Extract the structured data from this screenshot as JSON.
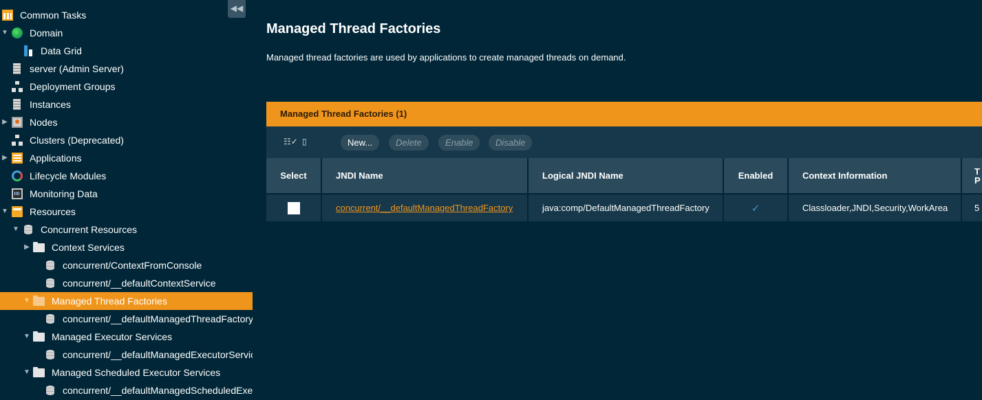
{
  "sidebar": {
    "collapse_glyph": "◀◀",
    "items": [
      {
        "label": "Common Tasks",
        "icon": "table-icon",
        "toggle": "",
        "level": 0
      },
      {
        "label": "Domain",
        "icon": "globe-icon",
        "toggle": "▼",
        "level": 0
      },
      {
        "label": "Data Grid",
        "icon": "data-grid-icon",
        "toggle": "",
        "level": 1
      },
      {
        "label": "server (Admin Server)",
        "icon": "server-icon",
        "toggle": "",
        "level": 0
      },
      {
        "label": "Deployment Groups",
        "icon": "tree-icon",
        "toggle": "",
        "level": 0
      },
      {
        "label": "Instances",
        "icon": "server-icon",
        "toggle": "",
        "level": 0
      },
      {
        "label": "Nodes",
        "icon": "monitor-icon",
        "toggle": "▶",
        "level": 0
      },
      {
        "label": "Clusters (Deprecated)",
        "icon": "tree-icon",
        "toggle": "",
        "level": 0
      },
      {
        "label": "Applications",
        "icon": "applications-icon",
        "toggle": "▶",
        "level": 0
      },
      {
        "label": "Lifecycle Modules",
        "icon": "lifecycle-icon",
        "toggle": "",
        "level": 0
      },
      {
        "label": "Monitoring Data",
        "icon": "monitoring-icon",
        "toggle": "",
        "level": 0
      },
      {
        "label": "Resources",
        "icon": "resources-icon",
        "toggle": "▼",
        "level": 0
      },
      {
        "label": "Concurrent Resources",
        "icon": "database-icon",
        "toggle": "▼",
        "level": 1
      },
      {
        "label": "Context Services",
        "icon": "folder-icon",
        "toggle": "▶",
        "level": 2
      },
      {
        "label": "concurrent/ContextFromConsole",
        "icon": "database-icon",
        "toggle": "",
        "level": 3
      },
      {
        "label": "concurrent/__defaultContextService",
        "icon": "database-icon",
        "toggle": "",
        "level": 3
      },
      {
        "label": "Managed Thread Factories",
        "icon": "folder-icon",
        "toggle": "▼",
        "level": 2,
        "selected": true
      },
      {
        "label": "concurrent/__defaultManagedThreadFactory",
        "icon": "database-icon",
        "toggle": "",
        "level": 3
      },
      {
        "label": "Managed Executor Services",
        "icon": "folder-icon",
        "toggle": "▼",
        "level": 2
      },
      {
        "label": "concurrent/__defaultManagedExecutorService",
        "icon": "database-icon",
        "toggle": "",
        "level": 3
      },
      {
        "label": "Managed Scheduled Executor Services",
        "icon": "folder-icon",
        "toggle": "▼",
        "level": 2
      },
      {
        "label": "concurrent/__defaultManagedScheduledExecutorService",
        "icon": "database-icon",
        "toggle": "",
        "level": 3
      }
    ]
  },
  "main": {
    "title": "Managed Thread Factories",
    "description": "Managed thread factories are used by applications to create managed threads on demand.",
    "panel_title": "Managed Thread Factories (1)",
    "toolbar": {
      "new_label": "New...",
      "delete_label": "Delete",
      "enable_label": "Enable",
      "disable_label": "Disable"
    },
    "table": {
      "headers": {
        "select": "Select",
        "jndi": "JNDI Name",
        "logical": "Logical JNDI Name",
        "enabled": "Enabled",
        "context": "Context Information",
        "thread_priority": "T P"
      },
      "rows": [
        {
          "jndi": "concurrent/__defaultManagedThreadFactory",
          "logical": "java:comp/DefaultManagedThreadFactory",
          "enabled": "✓",
          "context": "Classloader,JNDI,Security,WorkArea",
          "thread_priority": "5"
        }
      ]
    }
  },
  "colors": {
    "background": "#002637",
    "accent": "#f0951c",
    "header_cell": "#2b4a5b",
    "row_cell": "#17384a"
  }
}
